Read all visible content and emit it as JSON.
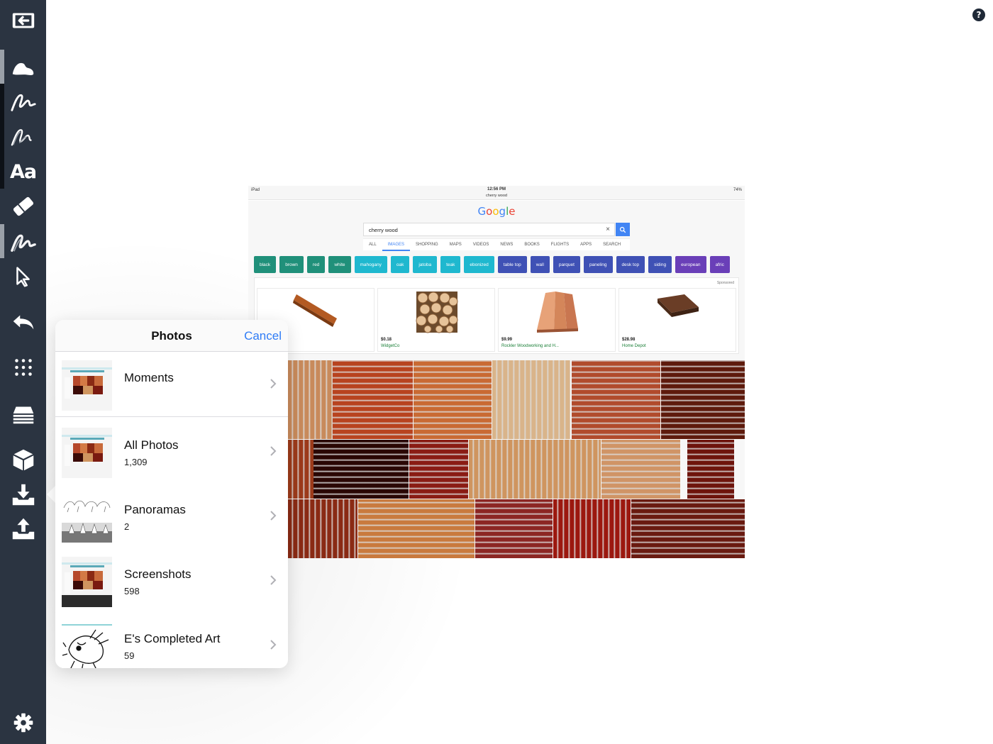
{
  "toolbar": {
    "items": [
      {
        "name": "exit-icon"
      },
      {
        "name": "brush-icon"
      },
      {
        "name": "pen-icon"
      },
      {
        "name": "pencil-icon"
      },
      {
        "name": "text-tool",
        "label": "Aa"
      },
      {
        "name": "eraser-icon"
      },
      {
        "name": "smudge-icon"
      },
      {
        "name": "select-arrow-icon"
      },
      {
        "name": "undo-icon"
      },
      {
        "name": "grid-icon"
      },
      {
        "name": "layers-icon"
      },
      {
        "name": "cube-icon"
      },
      {
        "name": "import-icon"
      },
      {
        "name": "export-icon"
      },
      {
        "name": "settings-gear-icon"
      }
    ]
  },
  "help": {
    "label": "?"
  },
  "screenshot": {
    "status_left": "iPad",
    "status_time": "12:56 PM",
    "status_url": "cherry wood",
    "status_battery": "74%",
    "logo": "Google",
    "search_value": "cherry wood",
    "clear": "×",
    "tabs": [
      "ALL",
      "IMAGES",
      "SHOPPING",
      "MAPS",
      "VIDEOS",
      "NEWS",
      "BOOKS",
      "FLIGHTS",
      "APPS",
      "SEARCH"
    ],
    "active_tab": "IMAGES",
    "chips": [
      {
        "label": "black",
        "color": "#20907a"
      },
      {
        "label": "brown",
        "color": "#20907a"
      },
      {
        "label": "red",
        "color": "#20907a"
      },
      {
        "label": "white",
        "color": "#20907a"
      },
      {
        "label": "mahogany",
        "color": "#1fb8cf"
      },
      {
        "label": "oak",
        "color": "#1fb8cf"
      },
      {
        "label": "jatoba",
        "color": "#1fb8cf"
      },
      {
        "label": "teak",
        "color": "#1fb8cf"
      },
      {
        "label": "ebonized",
        "color": "#1fb8cf"
      },
      {
        "label": "table top",
        "color": "#3f51b5"
      },
      {
        "label": "wall",
        "color": "#3f51b5"
      },
      {
        "label": "parquet",
        "color": "#3f51b5"
      },
      {
        "label": "paneling",
        "color": "#3f51b5"
      },
      {
        "label": "desk top",
        "color": "#3f51b5"
      },
      {
        "label": "siding",
        "color": "#3f51b5"
      },
      {
        "label": "european",
        "color": "#6a3fb8"
      },
      {
        "label": "afric",
        "color": "#6a3fb8"
      }
    ],
    "sponsored": "Sponsored",
    "ads": [
      {
        "price": "",
        "seller": ""
      },
      {
        "price": "$0.18",
        "seller": "WidgetCo"
      },
      {
        "price": "$9.99",
        "seller": "Rockler Woodworking and H..."
      },
      {
        "price": "$28.98",
        "seller": "Home Depot"
      }
    ],
    "wood_colors": [
      "#c88a5b",
      "#b8431f",
      "#c96a33",
      "#d9b48a",
      "#b14b2c",
      "#5e1a0c",
      "#9c3a1a",
      "#2a0704",
      "#8a1c14",
      "#cf955f",
      "#d09466",
      "#6e140c",
      "#8a2a14",
      "#c97a3e",
      "#8c2623",
      "#9c180f",
      "#6a1a10"
    ]
  },
  "photos": {
    "title": "Photos",
    "cancel": "Cancel",
    "albums": [
      {
        "name": "Moments",
        "count": ""
      },
      {
        "name": "All Photos",
        "count": "1,309"
      },
      {
        "name": "Panoramas",
        "count": "2"
      },
      {
        "name": "Screenshots",
        "count": "598"
      },
      {
        "name": "E's Completed Art",
        "count": "59"
      }
    ]
  }
}
